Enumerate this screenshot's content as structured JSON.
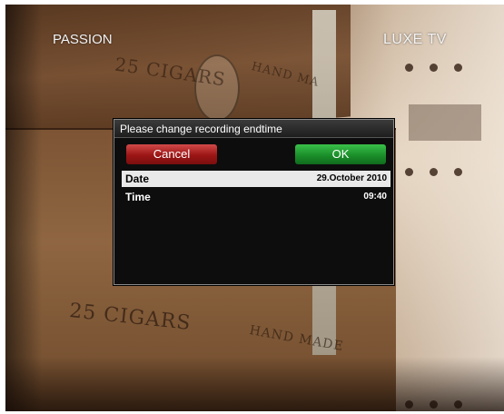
{
  "overlay": {
    "channel_left": "PASSION",
    "channel_right": "LUXE TV"
  },
  "background": {
    "stamp_top": "25 CIGARS",
    "stamp_top_right": "HAND MA",
    "stamp_bottom": "25 CIGARS",
    "stamp_bottom_right": "HAND MADE"
  },
  "dialog": {
    "title": "Please change recording endtime",
    "cancel_label": "Cancel",
    "ok_label": "OK",
    "rows": [
      {
        "label": "Date",
        "value": "29.October 2010",
        "selected": true
      },
      {
        "label": "Time",
        "value": "09:40",
        "selected": false
      }
    ]
  },
  "colors": {
    "cancel": "#b21f1f",
    "ok": "#1f9a2f",
    "selected_row": "#e9e9e9"
  }
}
